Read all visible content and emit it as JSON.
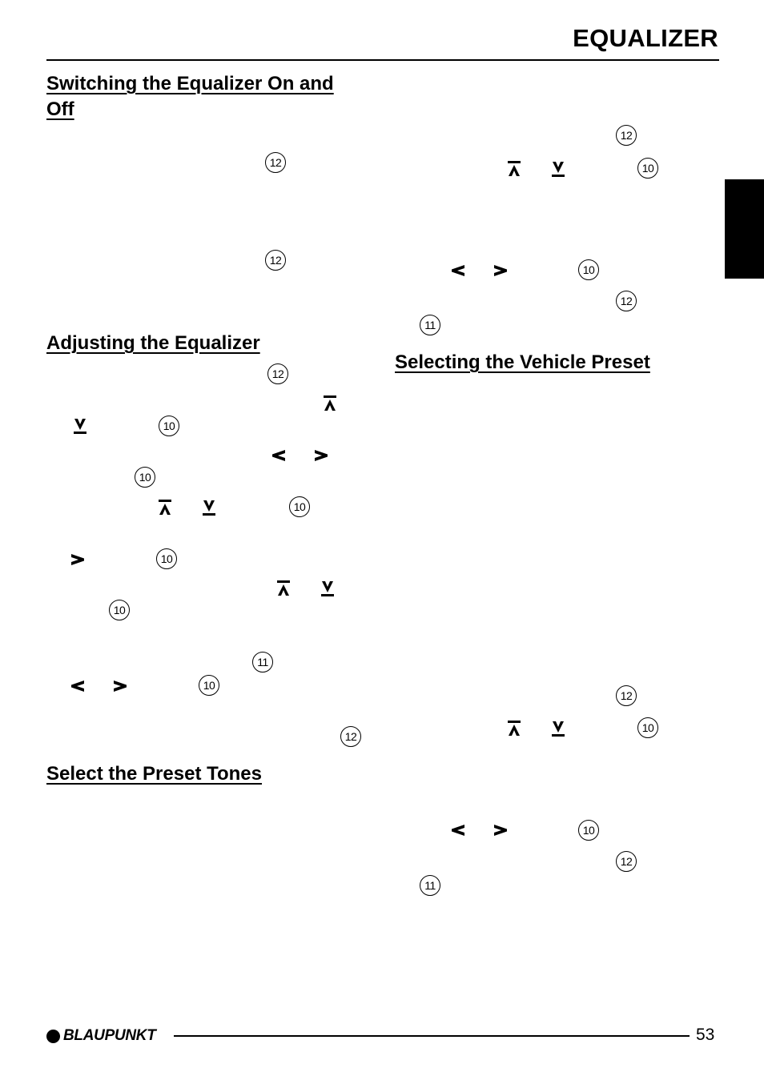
{
  "header": {
    "title": "EQUALIZER"
  },
  "sections": {
    "switching": {
      "heading_line1": "Switching the Equalizer On and",
      "heading_line2": "Off"
    },
    "adjusting": {
      "heading": "Adjusting the Equalizer"
    },
    "preset_tones": {
      "heading": "Select the Preset Tones"
    },
    "vehicle_preset": {
      "heading": "Selecting the Vehicle Preset"
    }
  },
  "callouts": {
    "c12": "12",
    "c10": "10",
    "c11": "11"
  },
  "keys": {
    "up": "up-arrow-key",
    "down": "down-arrow-key",
    "left": "left-arrow-key",
    "right": "right-arrow-key"
  },
  "footer": {
    "brand": "BLAUPUNKT",
    "page_number": "53"
  }
}
